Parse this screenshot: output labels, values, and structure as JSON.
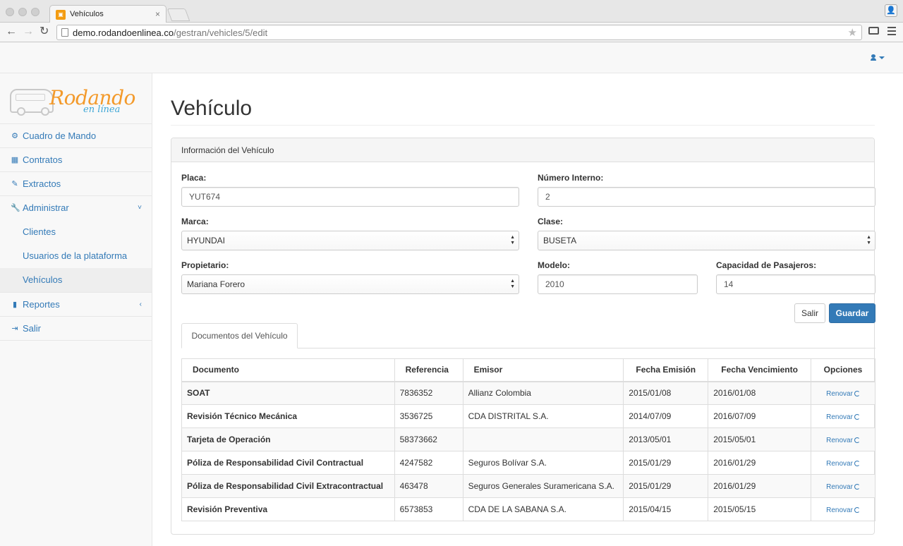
{
  "browser": {
    "tab_title": "Vehículos",
    "tab_close": "×",
    "url_host": "demo.rodandoenlinea.co",
    "url_path": "/gestran/vehicles/5/edit",
    "back": "←",
    "forward": "→",
    "reload": "↻",
    "star": "★"
  },
  "sidebar": {
    "logo_text": "Rodando",
    "logo_sub": "en línea",
    "items": [
      {
        "label": "Cuadro de Mando",
        "icon": "⚙"
      },
      {
        "label": "Contratos",
        "icon": "▦"
      },
      {
        "label": "Extractos",
        "icon": "✎"
      },
      {
        "label": "Administrar",
        "icon": "🔧",
        "chevron": "˅"
      },
      {
        "label": "Reportes",
        "icon": "▮",
        "chevron": "‹"
      },
      {
        "label": "Salir",
        "icon": "⇥"
      }
    ],
    "submenu": [
      {
        "label": "Clientes"
      },
      {
        "label": "Usuarios de la plataforma"
      },
      {
        "label": "Vehículos"
      }
    ]
  },
  "page": {
    "title": "Vehículo",
    "panel_title": "Información del Vehículo"
  },
  "form": {
    "placa_label": "Placa:",
    "placa_value": "YUT674",
    "numero_label": "Número Interno:",
    "numero_value": "2",
    "marca_label": "Marca:",
    "marca_value": "HYUNDAI",
    "clase_label": "Clase:",
    "clase_value": "BUSETA",
    "propietario_label": "Propietario:",
    "propietario_value": "Mariana Forero",
    "modelo_label": "Modelo:",
    "modelo_value": "2010",
    "capacidad_label": "Capacidad de Pasajeros:",
    "capacidad_value": "14",
    "select_arrows": "▲▼",
    "salir_button": "Salir",
    "guardar_button": "Guardar"
  },
  "documents": {
    "tab_label": "Documentos del Vehículo",
    "headers": [
      "Documento",
      "Referencia",
      "Emisor",
      "Fecha Emisión",
      "Fecha Vencimiento",
      "Opciones"
    ],
    "rows": [
      [
        "SOAT",
        "7836352",
        "Allianz Colombia",
        "2015/01/08",
        "2016/01/08",
        "Renovar"
      ],
      [
        "Revisión Técnico Mecánica",
        "3536725",
        "CDA DISTRITAL S.A.",
        "2014/07/09",
        "2016/07/09",
        "Renovar"
      ],
      [
        "Tarjeta de Operación",
        "58373662",
        "",
        "2013/05/01",
        "2015/05/01",
        "Renovar"
      ],
      [
        "Póliza de Responsabilidad Civil Contractual",
        "4247582",
        "Seguros Bolívar S.A.",
        "2015/01/29",
        "2016/01/29",
        "Renovar"
      ],
      [
        "Póliza de Responsabilidad Civil Extracontractual",
        "463478",
        "Seguros Generales Suramericana S.A.",
        "2015/01/29",
        "2016/01/29",
        "Renovar"
      ],
      [
        "Revisión Preventiva",
        "6573853",
        "CDA DE LA SABANA S.A.",
        "2015/04/15",
        "2015/05/15",
        "Renovar"
      ]
    ]
  },
  "colors": {
    "link": "#337ab7",
    "logo_orange": "#f39a2b",
    "logo_blue": "#3fa7d6"
  }
}
